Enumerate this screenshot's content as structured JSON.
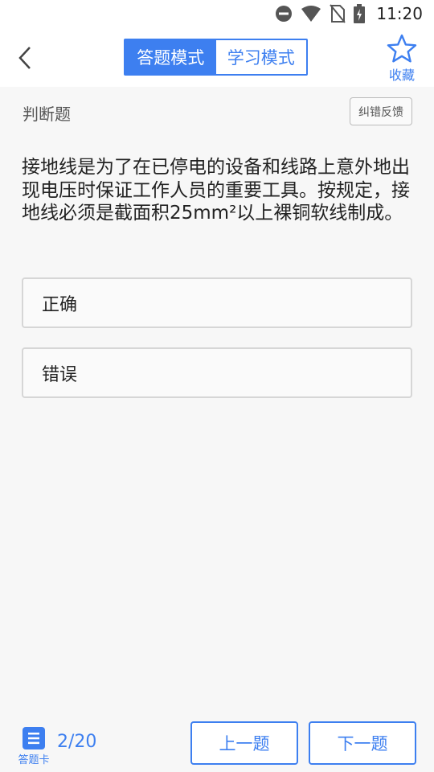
{
  "status_bar": {
    "time": "11:20"
  },
  "header": {
    "back_icon": "chevron-left-icon",
    "mode_tabs": [
      {
        "label": "答题模式",
        "active": true
      },
      {
        "label": "学习模式",
        "active": false
      }
    ],
    "favorite": {
      "icon": "star-outline-icon",
      "label": "收藏"
    }
  },
  "question": {
    "type_label": "判断题",
    "report_button": "纠错反馈",
    "text": "接地线是为了在已停电的设备和线路上意外地出现电压时保证工作人员的重要工具。按规定，接地线必须是截面积25mm²以上裸铜软线制成。",
    "options": [
      {
        "label": "正确"
      },
      {
        "label": "错误"
      }
    ]
  },
  "footer": {
    "answer_card_label": "答题卡",
    "progress": "2/20",
    "prev_label": "上一题",
    "next_label": "下一题"
  },
  "colors": {
    "accent": "#3d7ff0",
    "background": "#f7f7f7"
  }
}
